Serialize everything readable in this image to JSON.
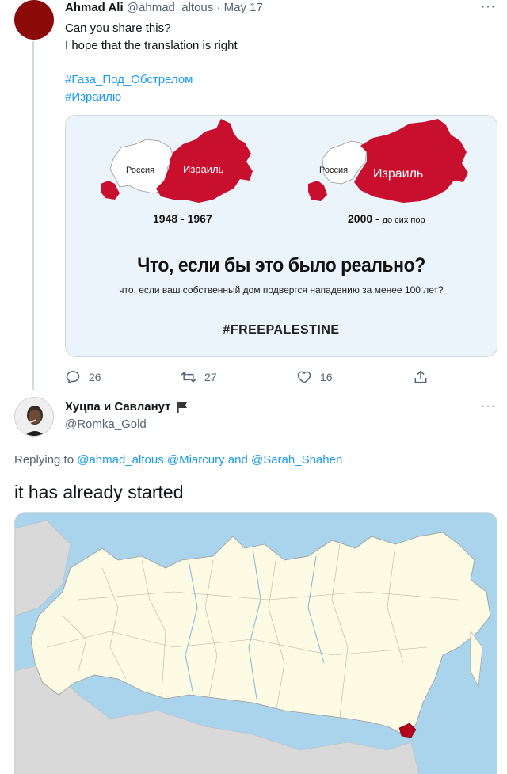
{
  "tweet1": {
    "author_name": "Ahmad Ali",
    "handle": "@ahmad_altous",
    "separator": "·",
    "date": "May 17",
    "text_line1": "Can you share this?",
    "text_line2": "I hope that the translation is right",
    "hashtag1": "#Газа_Под_Обстрелом",
    "hashtag2": "#Израилю",
    "card": {
      "left_russia_label": "Россия",
      "left_israel_label": "Израиль",
      "right_russia_label": "Россия",
      "right_israel_label": "Израиль",
      "left_year": "1948 - 1967",
      "right_year_main": "2000 -",
      "right_year_small": "до сих пор",
      "headline": "Что, если бы это было реально?",
      "subtitle": "что, если ваш собственный дом подвергся нападению за менее 100 лет?",
      "hashtag": "#FREEPALESTINE"
    },
    "replies_count": "26",
    "retweets_count": "27",
    "likes_count": "16"
  },
  "tweet2": {
    "author_name": "Хуцпа и Савланут",
    "handle": "@Romka_Gold",
    "replying_prefix": "Replying to",
    "reply_handle1": "@ahmad_altous",
    "reply_handle2": "@Miarcury",
    "reply_and": "and",
    "reply_handle3": "@Sarah_Shahen",
    "text": "it has already started"
  },
  "more_icon": "···",
  "colors": {
    "accent": "#1d9bf0",
    "muted": "#536471",
    "israel_red": "#c8102e",
    "map_land": "#fdfbe3",
    "map_water": "#a9d4ec",
    "map_highlight": "#b3001b"
  },
  "icons": [
    "reply-icon",
    "retweet-icon",
    "like-icon",
    "share-icon",
    "more-icon",
    "flag-icon"
  ]
}
